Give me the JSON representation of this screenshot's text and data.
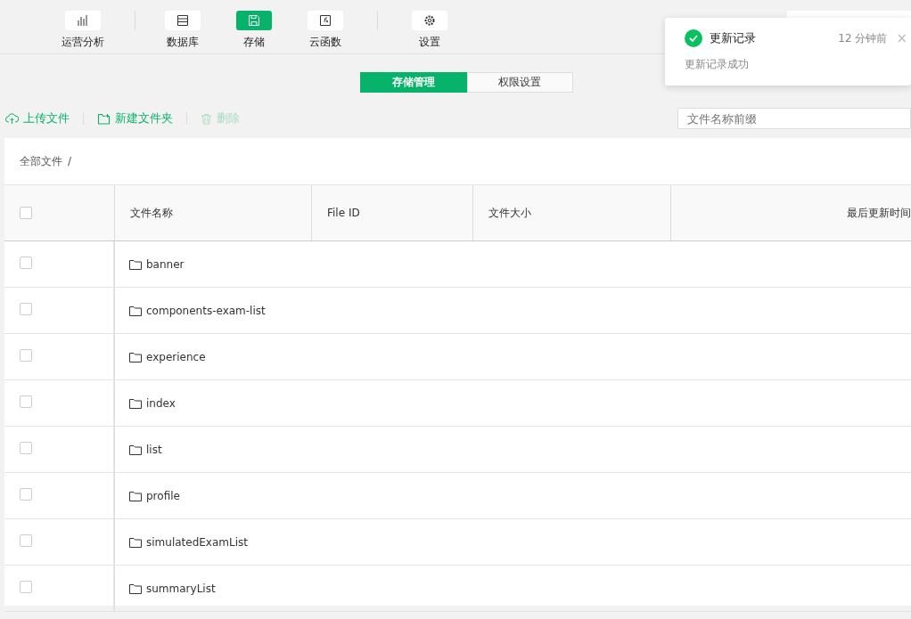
{
  "nav": {
    "items": [
      {
        "label": "运营分析",
        "selected": false
      },
      {
        "label": "数据库",
        "selected": false
      },
      {
        "label": "存储",
        "selected": true
      },
      {
        "label": "云函数",
        "selected": false
      },
      {
        "label": "设置",
        "selected": false
      }
    ]
  },
  "toast": {
    "title": "更新记录",
    "time": "12 分钟前",
    "close": "×",
    "message": "更新记录成功"
  },
  "tabs": [
    {
      "label": "存储管理",
      "selected": true
    },
    {
      "label": "权限设置",
      "selected": false
    }
  ],
  "toolbar": {
    "actions": [
      {
        "label": "上传文件",
        "disabled": false
      },
      {
        "label": "新建文件夹",
        "disabled": false
      },
      {
        "label": "删除",
        "disabled": true
      }
    ],
    "search": {
      "placeholder": "文件名称前缀"
    }
  },
  "breadcrumb": {
    "label": "全部文件",
    "sep": "/"
  },
  "table": {
    "select_all_checked": false,
    "columns": [
      "文件名称",
      "File ID",
      "文件大小",
      "最后更新时间"
    ],
    "rows": [
      {
        "name": "banner",
        "checked": false
      },
      {
        "name": "components-exam-list",
        "checked": false
      },
      {
        "name": "experience",
        "checked": false
      },
      {
        "name": "index",
        "checked": false
      },
      {
        "name": "list",
        "checked": false
      },
      {
        "name": "profile",
        "checked": false
      },
      {
        "name": "simulatedExamList",
        "checked": false
      },
      {
        "name": "summaryList",
        "checked": false
      }
    ]
  }
}
